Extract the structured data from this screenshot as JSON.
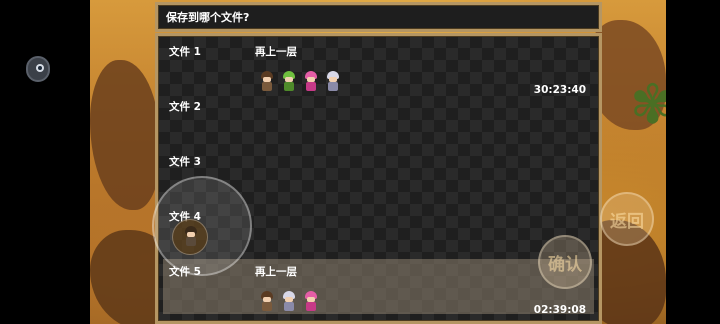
{
  "dialog": {
    "title": "保存到哪个文件?"
  },
  "save_slots": [
    {
      "label": "文件 1",
      "location": "再上一层",
      "time": "30:23:40",
      "selected": false,
      "party": [
        {
          "hair": "#5a3b22",
          "body": "#7a5a3c"
        },
        {
          "hair": "#6fbf3e",
          "body": "#4f8a2a"
        },
        {
          "hair": "#e45da6",
          "body": "#c63a87"
        },
        {
          "hair": "#d8d8e8",
          "body": "#8a8aa8"
        }
      ]
    },
    {
      "label": "文件 2",
      "location": "",
      "time": "",
      "selected": false,
      "party": []
    },
    {
      "label": "文件 3",
      "location": "",
      "time": "",
      "selected": false,
      "party": []
    },
    {
      "label": "文件 4",
      "location": "",
      "time": "",
      "selected": false,
      "party": []
    },
    {
      "label": "文件 5",
      "location": "再上一层",
      "time": "02:39:08",
      "selected": true,
      "party": [
        {
          "hair": "#5a3b22",
          "body": "#7a5a3c"
        },
        {
          "hair": "#d8d8e8",
          "body": "#8a8aa8"
        },
        {
          "hair": "#e45da6",
          "body": "#c63a87"
        }
      ]
    }
  ],
  "controls": {
    "back_label": "返回",
    "confirm_label": "确认"
  },
  "colors": {
    "frame": "#b59663",
    "window_bg": "#1f1f1f",
    "selected_bg": "#8c806e"
  },
  "icons": {
    "floating": "floating-assistant-icon",
    "joystick": "virtual-joystick-icon"
  }
}
